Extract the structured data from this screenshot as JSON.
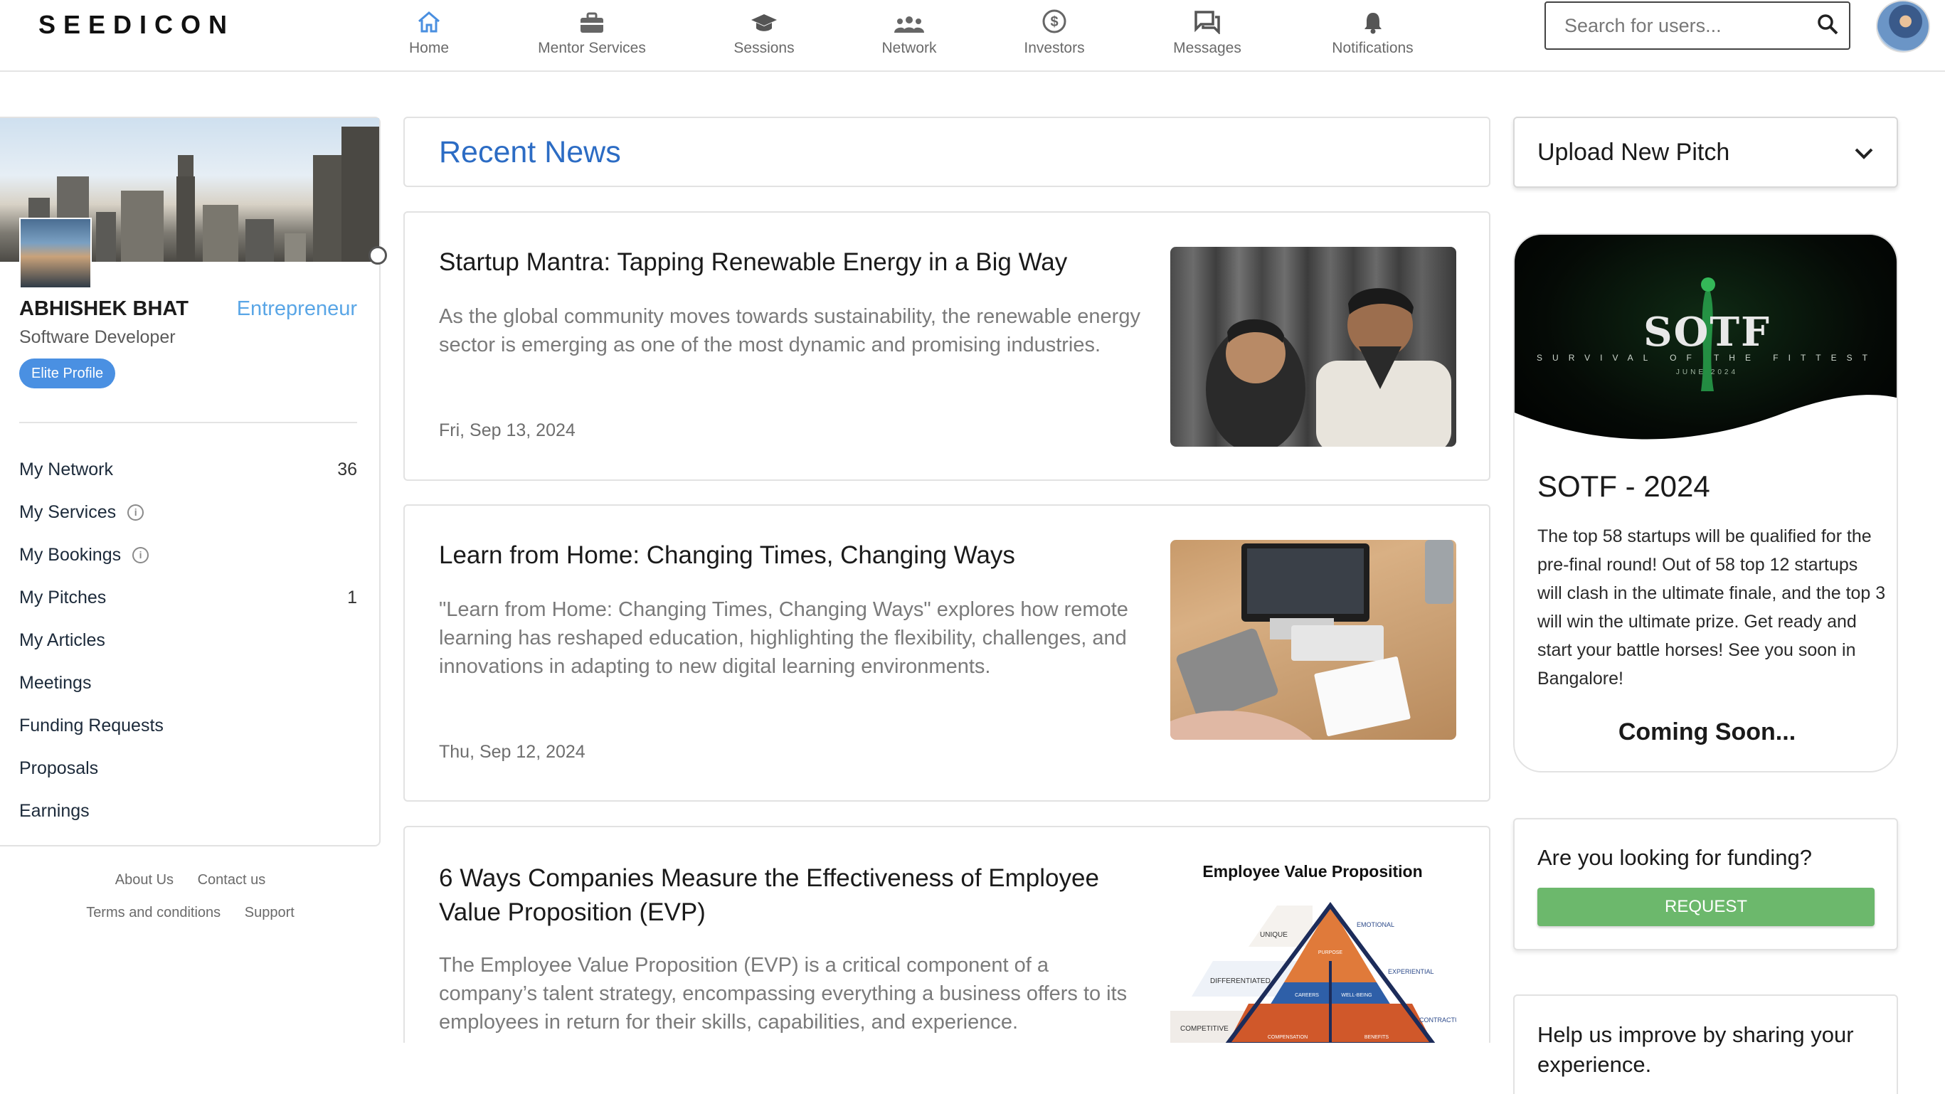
{
  "brand": {
    "logo": "SEEDICON"
  },
  "nav": [
    {
      "label": "Home",
      "icon": "home-icon"
    },
    {
      "label": "Mentor Services",
      "icon": "briefcase-icon"
    },
    {
      "label": "Sessions",
      "icon": "graduation-cap-icon"
    },
    {
      "label": "Network",
      "icon": "people-icon"
    },
    {
      "label": "Investors",
      "icon": "dollar-icon"
    },
    {
      "label": "Messages",
      "icon": "chat-icon"
    },
    {
      "label": "Notifications",
      "icon": "bell-icon"
    }
  ],
  "search": {
    "placeholder": "Search for users..."
  },
  "profile": {
    "name": "ABHISHEK BHAT",
    "role": "Entrepreneur",
    "title": "Software Developer",
    "badge": "Elite Profile"
  },
  "menu": [
    {
      "label": "My Network",
      "count": "36",
      "info": false
    },
    {
      "label": "My Services",
      "count": "",
      "info": true
    },
    {
      "label": "My Bookings",
      "count": "",
      "info": true
    },
    {
      "label": "My Pitches",
      "count": "1",
      "info": false
    },
    {
      "label": "My Articles",
      "count": "",
      "info": false
    },
    {
      "label": "Meetings",
      "count": "",
      "info": false
    },
    {
      "label": "Funding Requests",
      "count": "",
      "info": false
    },
    {
      "label": "Proposals",
      "count": "",
      "info": false
    },
    {
      "label": "Earnings",
      "count": "",
      "info": false
    }
  ],
  "footer": {
    "about": "About Us",
    "contact": "Contact us",
    "terms": "Terms and conditions",
    "support": "Support"
  },
  "news": {
    "heading": "Recent News",
    "items": [
      {
        "title": "Startup Mantra: Tapping Renewable Energy in a Big Way",
        "description": "As the global community moves towards sustainability, the renewable energy sector is emerging as one of the most dynamic and promising industries.",
        "date": "Fri, Sep 13, 2024"
      },
      {
        "title": "Learn from Home: Changing Times, Changing Ways",
        "description": "\"Learn from Home: Changing Times, Changing Ways\" explores how remote learning has reshaped education, highlighting the flexibility, challenges, and innovations in adapting to new digital learning environments.",
        "date": "Thu, Sep 12, 2024"
      },
      {
        "title": "6 Ways Companies Measure the Effectiveness of Employee Value Proposition (EVP)",
        "description": "The Employee Value Proposition (EVP) is a critical component of a company’s talent strategy, encompassing everything a business offers to its employees in return for their skills, capabilities, and experience.",
        "date": ""
      }
    ],
    "evp_image": {
      "title": "Employee Value Proposition",
      "left_labels": [
        "UNIQUE",
        "DIFFERENTIATED",
        "COMPETITIVE"
      ],
      "right_labels": [
        "EMOTIONAL",
        "EXPERIENTIAL",
        "CONTRACTU"
      ],
      "cells": [
        "PURPOSE",
        "CAREERS",
        "WELL-BEING",
        "COMPENSATION",
        "BENEFITS"
      ]
    }
  },
  "pitch": {
    "label": "Upload New Pitch"
  },
  "sotf": {
    "banner_logo": "SOTF",
    "banner_sub": "SURVIVAL OF THE FITTEST",
    "banner_date": "JUNE 2024",
    "heading": "SOTF - 2024",
    "text": "The top 58 startups will be qualified for the pre-final round! Out of 58 top 12 startups will clash in the ultimate finale, and the top 3 will win the ultimate prize. Get ready and start your battle horses! See you soon in Bangalore!",
    "coming_soon": "Coming Soon..."
  },
  "funding": {
    "question": "Are you looking for funding?",
    "button": "REQUEST"
  },
  "help": {
    "text": "Help us improve by sharing your experience."
  },
  "colors": {
    "accent": "#2c6cc4",
    "role": "#5aa6e6",
    "badge": "#4a90e2",
    "request": "#6cb86c"
  }
}
